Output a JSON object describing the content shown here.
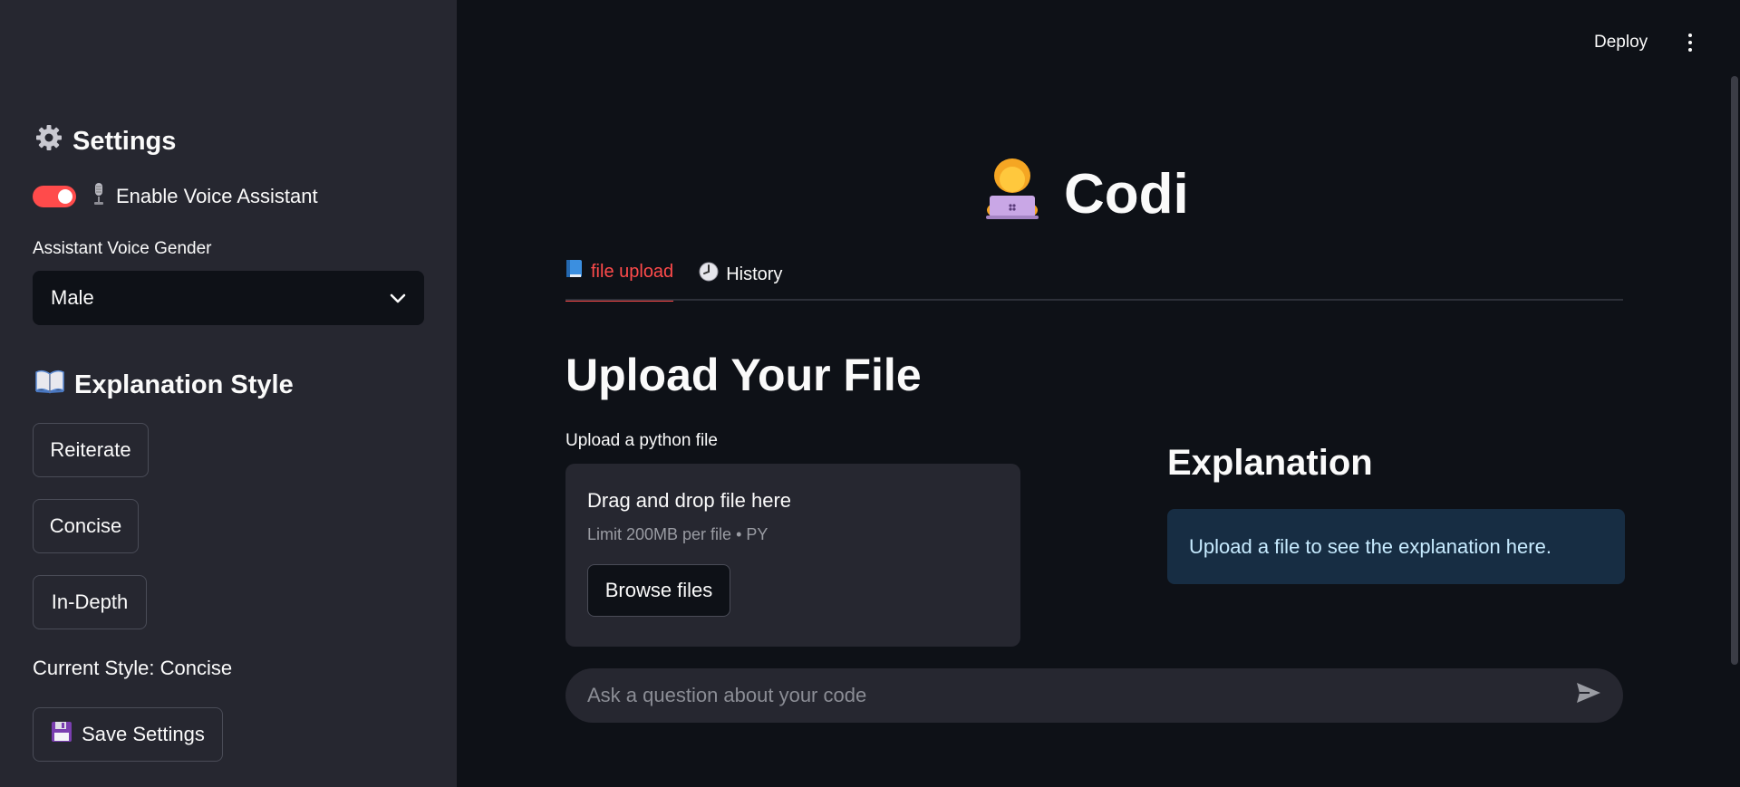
{
  "sidebar": {
    "settings_heading": "Settings",
    "settings_icon": "gear-icon",
    "voice_toggle_label": "Enable Voice Assistant",
    "voice_toggle_on": true,
    "voice_gender_label": "Assistant Voice Gender",
    "voice_gender_value": "Male",
    "explanation_heading": "Explanation Style",
    "style_buttons": [
      "Reiterate",
      "Concise",
      "In-Depth"
    ],
    "current_style": "Current Style: Concise",
    "save_button": "Save Settings"
  },
  "header": {
    "deploy": "Deploy"
  },
  "main": {
    "app_title": "Codi",
    "tabs": [
      {
        "label": "file upload",
        "icon": "blue-book-icon",
        "active": true
      },
      {
        "label": "History",
        "icon": "clock-icon",
        "active": false
      }
    ],
    "upload_heading": "Upload Your File",
    "upload_label": "Upload a python file",
    "dropzone_title": "Drag and drop file here",
    "dropzone_limit": "Limit 200MB per file • PY",
    "browse_button": "Browse files",
    "explanation_heading": "Explanation",
    "explanation_info": "Upload a file to see the explanation here.",
    "chat_placeholder": "Ask a question about your code"
  },
  "colors": {
    "accent": "#ff4b4b",
    "sidebar_bg": "#262730",
    "main_bg": "#0e1117",
    "info_bg": "#172d43"
  }
}
